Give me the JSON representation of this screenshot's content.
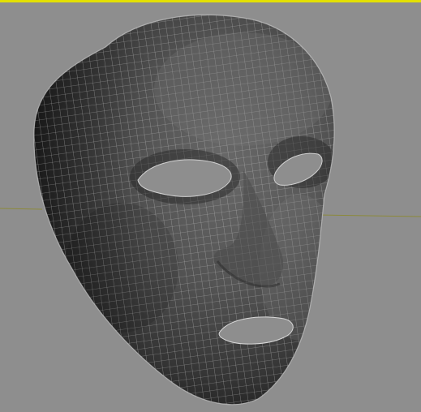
{
  "viewport": {
    "border_color": "#e4e000",
    "background_color": "#8e8e8e",
    "grid_line_color": "#8a8a2e",
    "wire_color": "#c8c8c8",
    "mesh_shade_light": "#6a6a6a",
    "mesh_shade_dark": "#1e1e1e",
    "hole_color": "#8e8e8e"
  },
  "model": {
    "name": "face-mesh",
    "features": [
      "left-eye-hole",
      "right-eye-hole",
      "nose",
      "mouth-hole"
    ]
  }
}
